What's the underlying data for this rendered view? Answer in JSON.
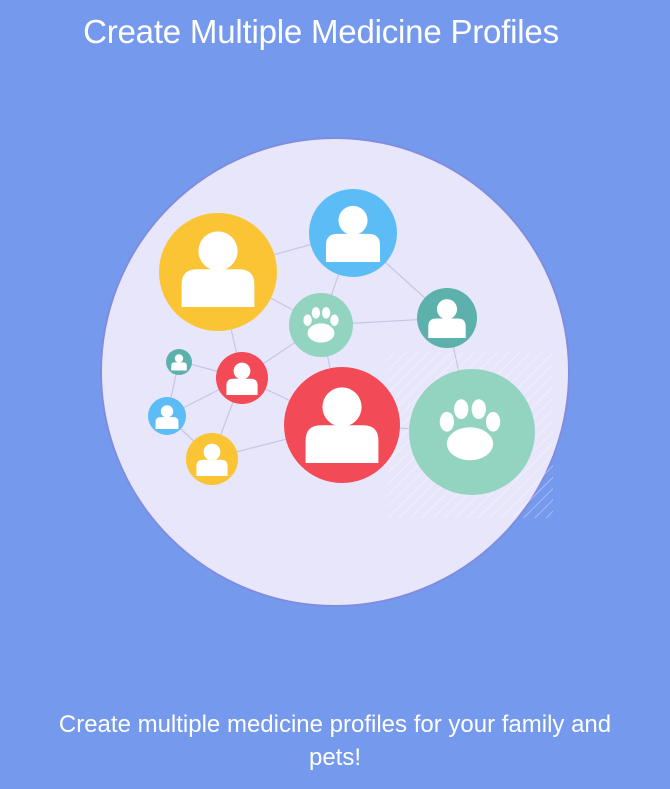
{
  "screen": {
    "title": "Create Multiple Medicine Profiles",
    "description": "Create multiple medicine profiles for your family and pets!"
  },
  "colors": {
    "background": "#7599ec",
    "circle_fill": "#e8e6fb",
    "circle_border": "#7f8de0",
    "yellow": "#fbc434",
    "blue": "#5bbcf6",
    "red": "#f24a56",
    "teal": "#5db1ac",
    "mint": "#93d4c0"
  },
  "illustration": {
    "profiles": [
      {
        "icon": "person-icon",
        "color": "yellow"
      },
      {
        "icon": "person-icon",
        "color": "blue"
      },
      {
        "icon": "paw-icon",
        "color": "mint"
      },
      {
        "icon": "person-icon",
        "color": "teal"
      },
      {
        "icon": "person-icon",
        "color": "teal"
      },
      {
        "icon": "person-icon",
        "color": "red"
      },
      {
        "icon": "person-icon",
        "color": "blue"
      },
      {
        "icon": "person-icon",
        "color": "yellow"
      },
      {
        "icon": "person-icon",
        "color": "red"
      },
      {
        "icon": "paw-icon",
        "color": "mint"
      }
    ]
  }
}
